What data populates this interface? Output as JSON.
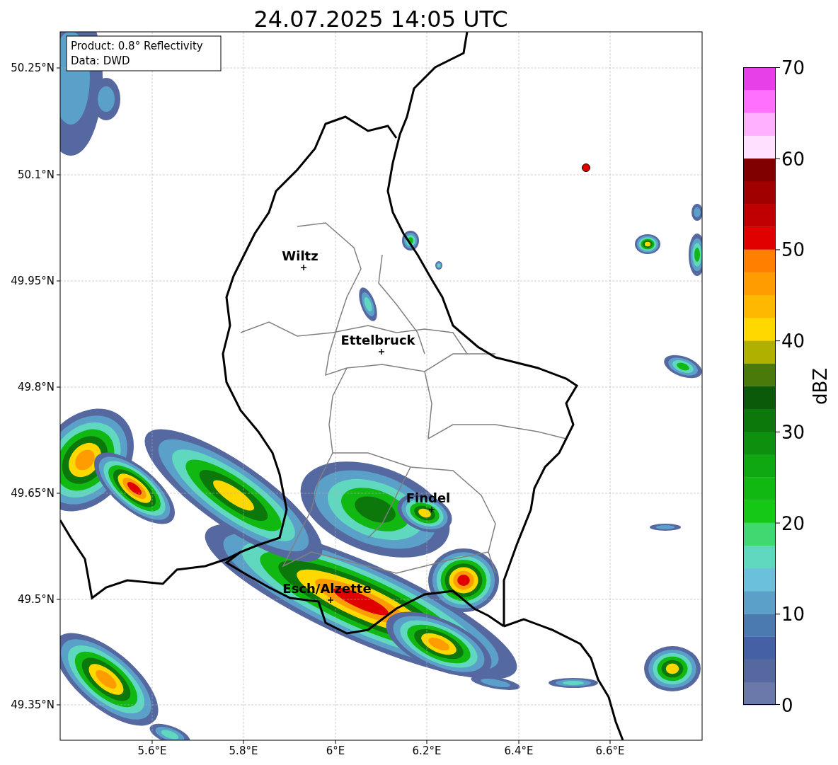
{
  "title": "24.07.2025 14:05 UTC",
  "info_box": [
    "Product: 0.8° Reflectivity",
    "Data: DWD"
  ],
  "map": {
    "lat_ticks": [
      "50.25°N",
      "50.1°N",
      "49.95°N",
      "49.8°N",
      "49.65°N",
      "49.5°N",
      "49.35°N"
    ],
    "lon_ticks": [
      "5.6°E",
      "5.8°E",
      "6°E",
      "6.2°E",
      "6.4°E",
      "6.6°E"
    ],
    "cities": [
      {
        "name": "Wiltz"
      },
      {
        "name": "Ettelbruck"
      },
      {
        "name": "Findel"
      },
      {
        "name": "Esch/Alzette"
      }
    ]
  },
  "colorbar": {
    "label": "dBZ",
    "ticks": [
      "70",
      "60",
      "50",
      "40",
      "30",
      "20",
      "10",
      "0"
    ]
  }
}
